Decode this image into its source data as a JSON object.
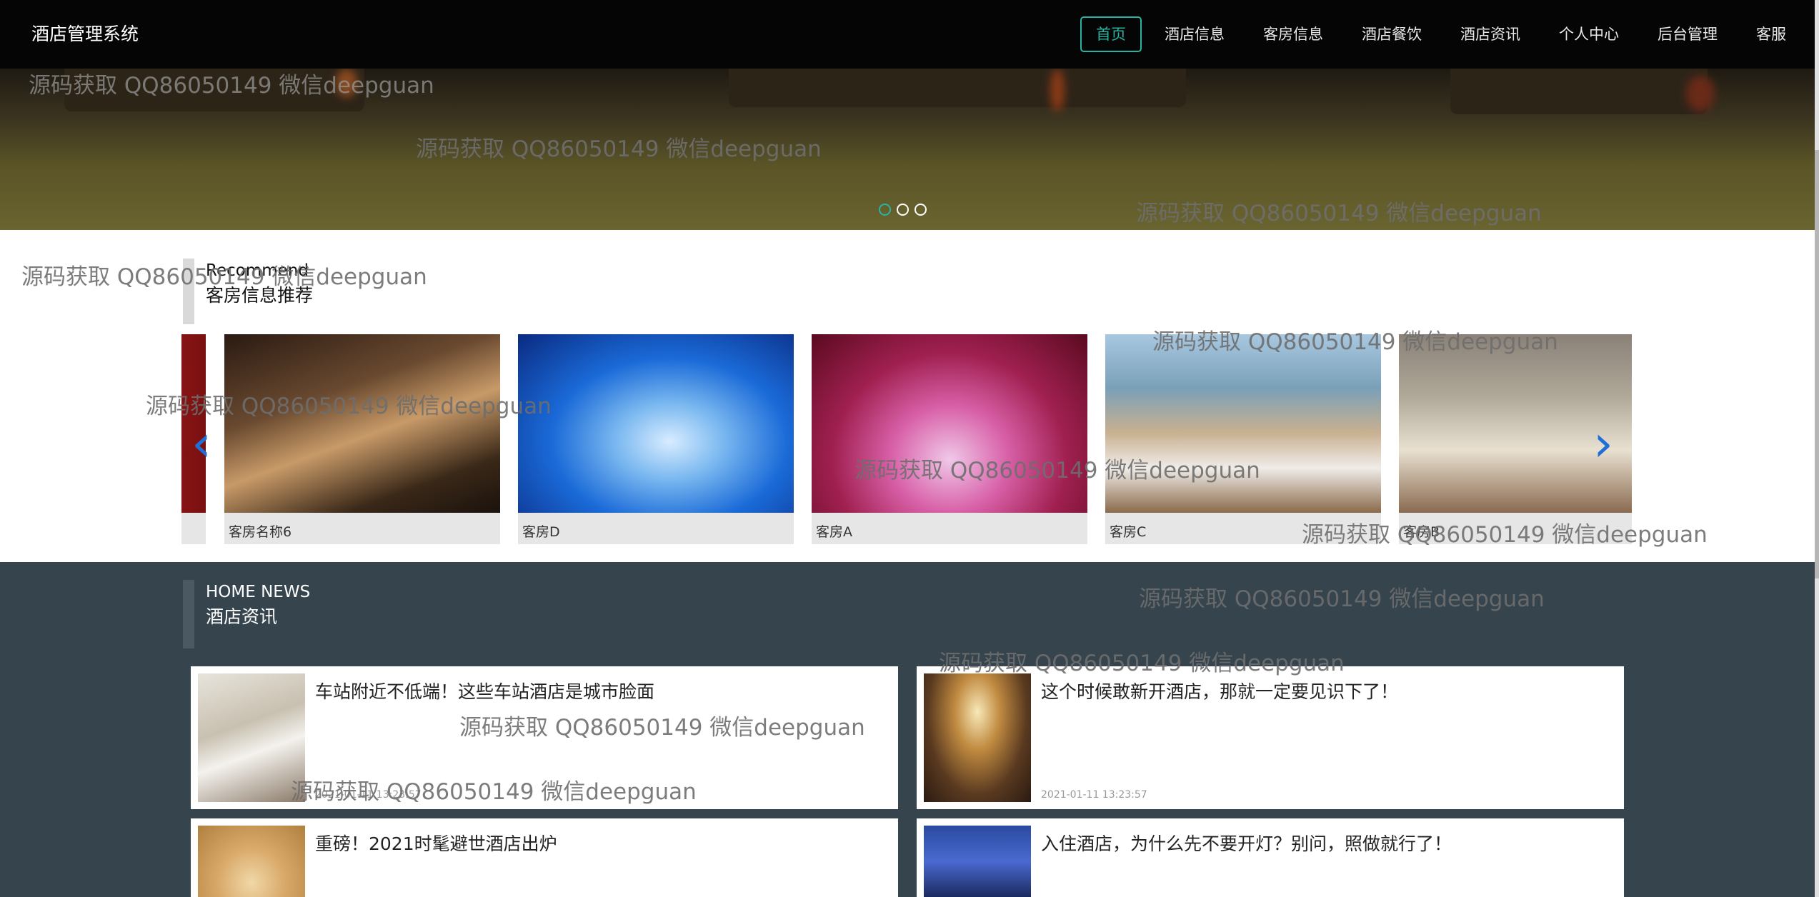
{
  "header": {
    "brand": "酒店管理系统",
    "nav": [
      "首页",
      "酒店信息",
      "客房信息",
      "酒店餐饮",
      "酒店资讯",
      "个人中心",
      "后台管理",
      "客服"
    ],
    "active_index": 0
  },
  "banner": {
    "slides": 3,
    "active_slide": 0
  },
  "recommend": {
    "title_en": "Recommend",
    "title_cn": "客房信息推荐",
    "rooms": [
      {
        "name": "客房名称6"
      },
      {
        "name": "客房D"
      },
      {
        "name": "客房A"
      },
      {
        "name": "客房C"
      },
      {
        "name": "客房B"
      }
    ],
    "prev_icon": "chevron-left-icon",
    "next_icon": "chevron-right-icon"
  },
  "news": {
    "title_en": "HOME NEWS",
    "title_cn": "酒店资讯",
    "items": [
      {
        "title": "车站附近不低端！这些车站酒店是城市脸面",
        "date": "2021-01-11 13:23:57"
      },
      {
        "title": "这个时候敢新开酒店，那就一定要见识下了！",
        "date": "2021-01-11 13:23:57"
      },
      {
        "title": "重磅！2021时髦避世酒店出炉",
        "date": ""
      },
      {
        "title": "入住酒店，为什么先不要开灯？别问，照做就行了！",
        "date": ""
      }
    ]
  },
  "watermark": "源码获取 QQ86050149 微信deepguan",
  "colors": {
    "accent": "#28b4a0",
    "topbar": "#050505",
    "news_bg": "#35444d",
    "arrow": "#1e6fd8"
  }
}
